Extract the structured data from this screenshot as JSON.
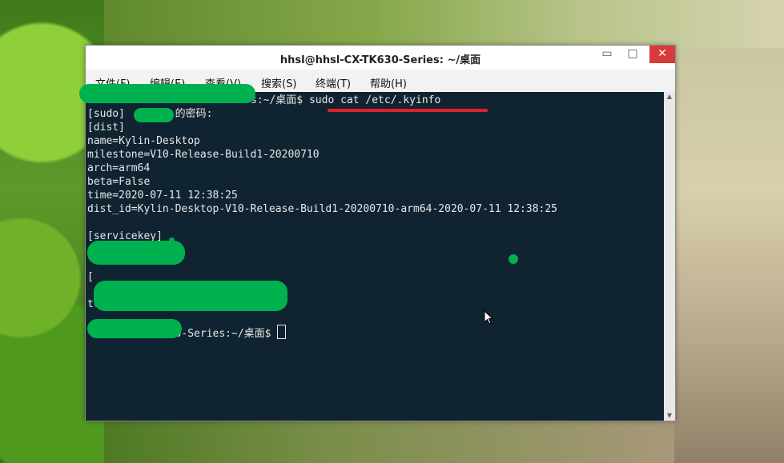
{
  "window": {
    "title": "hhsl@hhsl-CX-TK630-Series: ~/桌面",
    "minimize_glyph": "▭",
    "maximize_glyph": "□",
    "close_glyph": "✕"
  },
  "menu": [
    "文件(F)",
    "编辑(E)",
    "查看(V)",
    "搜索(S)",
    "终端(T)",
    "帮助(H)"
  ],
  "terminal": {
    "lines": [
      "s:~/桌面$ sudo cat /etc/.kyinfo",
      "[sudo]        的密码:",
      "[dist]",
      "name=Kylin-Desktop",
      "milestone=V10-Release-Build1-20200710",
      "arch=arm64",
      "beta=False",
      "time=2020-07-11 12:38:25",
      "dist_id=Kylin-Desktop-V10-Release-Build1-20200710-arm64-2020-07-11 12:38:25",
      "",
      "[servicekey]",
      "",
      "",
      "[",
      "",
      "tc",
      "",
      "          TK630-Series:~/桌面$ "
    ]
  },
  "colors": {
    "terminal_bg": "#0f2430",
    "terminal_fg": "#e8e8e8",
    "redaction": "#00b14f",
    "underline": "#e0202a",
    "close_button": "#d93b3b"
  }
}
